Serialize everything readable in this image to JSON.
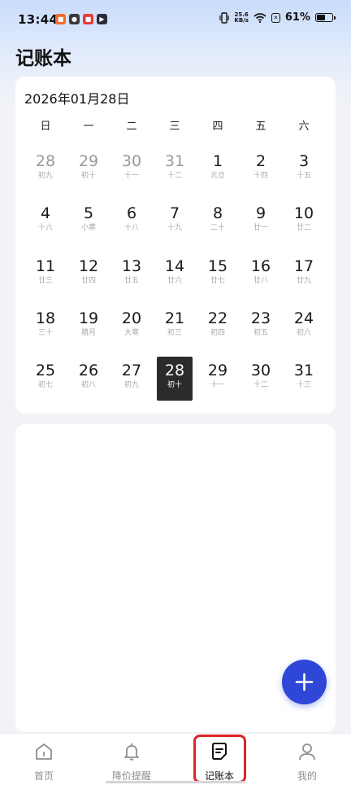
{
  "status_bar": {
    "time": "13:44",
    "net_speed_value": "25.6",
    "net_speed_unit": "KB/s",
    "battery_percent": "61%",
    "battery_level": 0.61
  },
  "page": {
    "title": "记账本"
  },
  "calendar": {
    "heading": "2026年01月28日",
    "weekdays": [
      "日",
      "一",
      "二",
      "三",
      "四",
      "五",
      "六"
    ],
    "weeks": [
      [
        {
          "num": "28",
          "lunar": "初九",
          "muted": true
        },
        {
          "num": "29",
          "lunar": "初十",
          "muted": true
        },
        {
          "num": "30",
          "lunar": "十一",
          "muted": true
        },
        {
          "num": "31",
          "lunar": "十二",
          "muted": true
        },
        {
          "num": "1",
          "lunar": "元旦"
        },
        {
          "num": "2",
          "lunar": "十四"
        },
        {
          "num": "3",
          "lunar": "十五"
        }
      ],
      [
        {
          "num": "4",
          "lunar": "十六"
        },
        {
          "num": "5",
          "lunar": "小寒"
        },
        {
          "num": "6",
          "lunar": "十八"
        },
        {
          "num": "7",
          "lunar": "十九"
        },
        {
          "num": "8",
          "lunar": "二十"
        },
        {
          "num": "9",
          "lunar": "廿一"
        },
        {
          "num": "10",
          "lunar": "廿二"
        }
      ],
      [
        {
          "num": "11",
          "lunar": "廿三"
        },
        {
          "num": "12",
          "lunar": "廿四"
        },
        {
          "num": "13",
          "lunar": "廿五"
        },
        {
          "num": "14",
          "lunar": "廿六"
        },
        {
          "num": "15",
          "lunar": "廿七"
        },
        {
          "num": "16",
          "lunar": "廿八"
        },
        {
          "num": "17",
          "lunar": "廿九"
        }
      ],
      [
        {
          "num": "18",
          "lunar": "三十"
        },
        {
          "num": "19",
          "lunar": "腊月"
        },
        {
          "num": "20",
          "lunar": "大寒"
        },
        {
          "num": "21",
          "lunar": "初三"
        },
        {
          "num": "22",
          "lunar": "初四"
        },
        {
          "num": "23",
          "lunar": "初五"
        },
        {
          "num": "24",
          "lunar": "初六"
        }
      ],
      [
        {
          "num": "25",
          "lunar": "初七"
        },
        {
          "num": "26",
          "lunar": "初八"
        },
        {
          "num": "27",
          "lunar": "初九"
        },
        {
          "num": "28",
          "lunar": "初十",
          "selected": true
        },
        {
          "num": "29",
          "lunar": "十一"
        },
        {
          "num": "30",
          "lunar": "十二"
        },
        {
          "num": "31",
          "lunar": "十三"
        }
      ]
    ]
  },
  "fab": {
    "icon": "plus-icon"
  },
  "bottom_nav": {
    "items": [
      {
        "label": "首页",
        "icon": "home-icon",
        "name": "nav-home"
      },
      {
        "label": "降价提醒",
        "icon": "bell-icon",
        "name": "nav-price-alert"
      },
      {
        "label": "记账本",
        "icon": "notebook-icon",
        "name": "nav-ledger",
        "active": true
      },
      {
        "label": "我的",
        "icon": "person-icon",
        "name": "nav-profile"
      }
    ]
  },
  "colors": {
    "accent": "#2e47d6",
    "selected_day": "#2b2b2b",
    "highlight_box": "#e0222a"
  }
}
